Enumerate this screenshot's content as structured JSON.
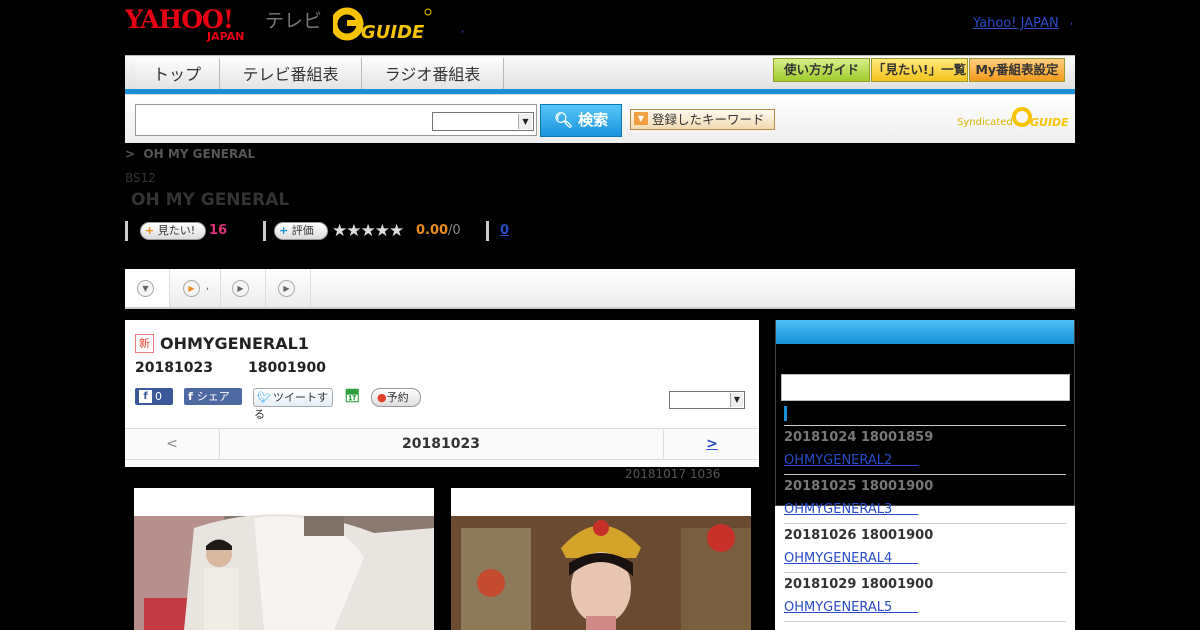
{
  "header": {
    "brand_yahoo": "YAHOO! JAPAN",
    "brand_tv": "テレビ",
    "brand_guide": "GUIDE",
    "yahoo_japan_link": "Yahoo! JAPAN",
    "dot1": ",",
    "dot2": ",",
    "dot3": ","
  },
  "nav": {
    "tabs": [
      "トップ",
      "テレビ番組表",
      "ラジオ番組表"
    ],
    "buttons": [
      "使い方ガイド",
      "「見たい!」一覧",
      "My番組表設定"
    ]
  },
  "search": {
    "button_label": "検索",
    "keyword_button": "登録したキーワード",
    "syndicated": "Syndicated",
    "syndicated_logo": "GUIDE"
  },
  "breadcrumb": {
    "arrow": ">",
    "current": "OH MY GENERAL"
  },
  "program": {
    "channel": "BS12",
    "title": "OH MY GENERAL",
    "want_button": "見たい!",
    "want_count": "16",
    "rate_button": "評価",
    "stars": "★★★★★",
    "score": "0.00",
    "score_of": "/0",
    "reviews": "0"
  },
  "tabs": {
    "tab2_suffix": ","
  },
  "episode": {
    "new_badge": "新",
    "title": "OHMYGENERAL1",
    "date": "20181023",
    "time": "18001900",
    "fb_like_count": "0",
    "share_label": "シェア",
    "tweet_label": "ツイートする",
    "reserve_label": "予約",
    "prev": "<",
    "nav_date": "20181023",
    "next": ">",
    "updated": "20181017  1036"
  },
  "sidebar": {
    "slots": [
      {
        "datetime": "20181024  18001859",
        "link": "OHMYGENERAL2　　"
      },
      {
        "datetime": "20181025  18001900",
        "link": "OHMYGENERAL3　　"
      },
      {
        "datetime": "20181026  18001900",
        "link": "OHMYGENERAL4　　"
      },
      {
        "datetime": "20181029  18001900",
        "link": "OHMYGENERAL5　　"
      }
    ]
  },
  "colors": {
    "accent_blue": "#1a8fd6",
    "link": "#2a4bc6",
    "want_pink": "#e0307a",
    "score_orange": "#e88e1e"
  }
}
